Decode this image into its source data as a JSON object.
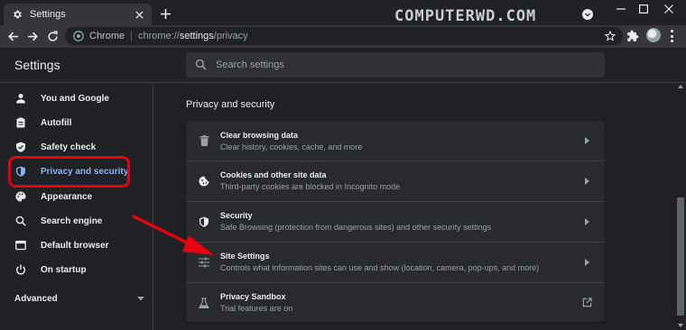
{
  "tab": {
    "title": "Settings",
    "icon": "gear-icon"
  },
  "watermark": "COMPUTERWD.COM",
  "omnibox": {
    "chip": "Chrome",
    "separator": "|",
    "url_scheme": "chrome://",
    "url_host": "settings",
    "url_path": "/privacy"
  },
  "header": {
    "title": "Settings",
    "search_placeholder": "Search settings"
  },
  "sidebar": {
    "items": [
      {
        "label": "You and Google",
        "icon": "person-icon"
      },
      {
        "label": "Autofill",
        "icon": "clipboard-icon"
      },
      {
        "label": "Safety check",
        "icon": "shield-check-icon"
      },
      {
        "label": "Privacy and security",
        "icon": "shield-icon",
        "active": true
      },
      {
        "label": "Appearance",
        "icon": "palette-icon"
      },
      {
        "label": "Search engine",
        "icon": "search-icon"
      },
      {
        "label": "Default browser",
        "icon": "browser-icon"
      },
      {
        "label": "On startup",
        "icon": "power-icon"
      }
    ],
    "advanced": "Advanced"
  },
  "main": {
    "section_title": "Privacy and security",
    "rows": [
      {
        "title": "Clear browsing data",
        "subtitle": "Clear history, cookies, cache, and more",
        "icon": "trash-icon",
        "action": "chevron-right-icon"
      },
      {
        "title": "Cookies and other site data",
        "subtitle": "Third-party cookies are blocked in Incognito mode",
        "icon": "cookie-icon",
        "action": "chevron-right-icon"
      },
      {
        "title": "Security",
        "subtitle": "Safe Browsing (protection from dangerous sites) and other security settings",
        "icon": "shield-icon",
        "action": "chevron-right-icon"
      },
      {
        "title": "Site Settings",
        "subtitle": "Controls what information sites can use and show (location, camera, pop-ups, and more)",
        "icon": "tune-icon",
        "action": "chevron-right-icon"
      },
      {
        "title": "Privacy Sandbox",
        "subtitle": "Trial features are on",
        "icon": "flask-icon",
        "action": "open-in-new-icon"
      }
    ]
  },
  "colors": {
    "accent": "#8ab4f8",
    "highlight": "#e8000f",
    "background": "#202124",
    "card": "#292a2d"
  }
}
